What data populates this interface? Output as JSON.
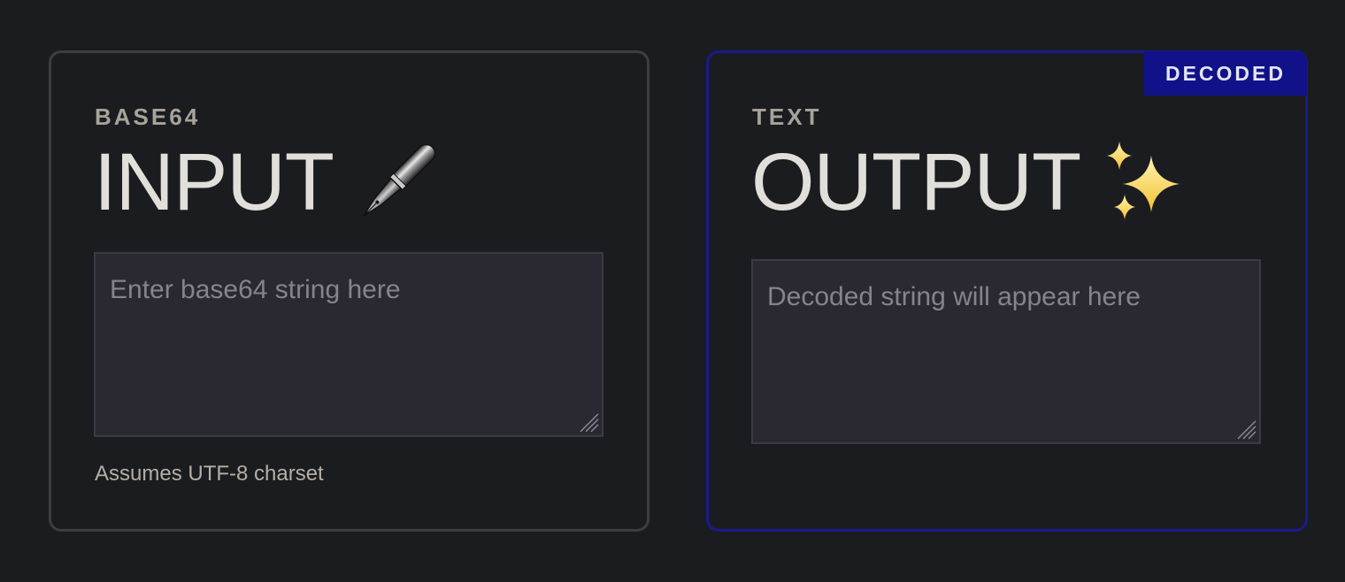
{
  "input_panel": {
    "eyebrow": "BASE64",
    "title": "INPUT",
    "title_icon": "fountain-pen-icon",
    "placeholder": "Enter base64 string here",
    "value": "",
    "hint": "Assumes UTF-8 charset",
    "border_color": "#3d3e42"
  },
  "output_panel": {
    "eyebrow": "TEXT",
    "title": "OUTPUT",
    "title_icon": "sparkles-icon",
    "placeholder": "Decoded string will appear here",
    "value": "",
    "badge": "DECODED",
    "border_color": "#1a1a8c",
    "badge_color": "#11118a"
  },
  "colors": {
    "background": "#1b1c1f",
    "field_background": "#2a2932",
    "heading": "#e1dfd9",
    "muted_label": "#a8a39a"
  }
}
